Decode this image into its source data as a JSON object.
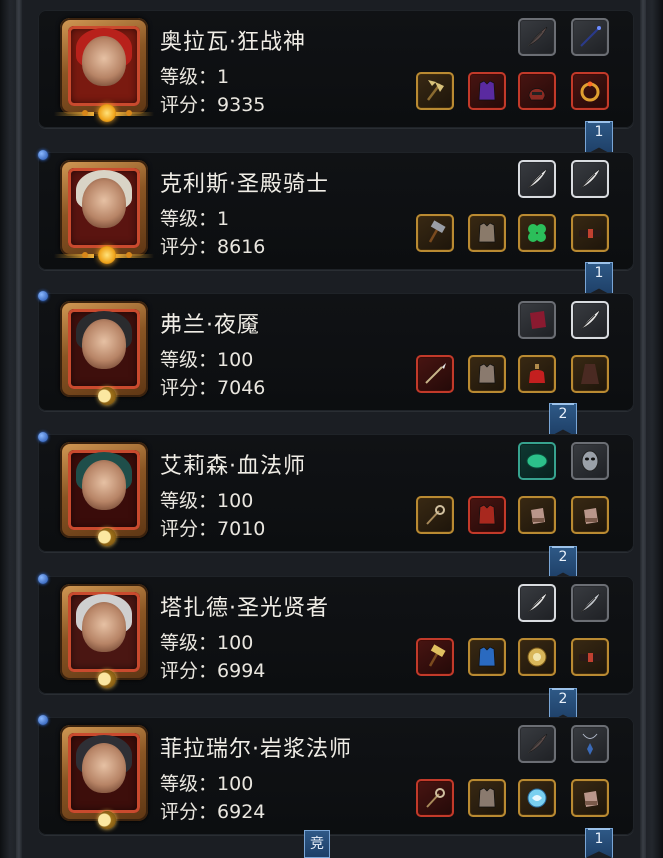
{
  "level_label": "等级：",
  "score_label": "评分：",
  "heroes": [
    {
      "name": "奥拉瓦·狂战神",
      "level": "1",
      "score": "9335",
      "rank_flag": "1",
      "badge": "sun",
      "hair": "#b8211b",
      "bg": "#7a1a10"
    },
    {
      "name": "克利斯·圣殿骑士",
      "level": "1",
      "score": "8616",
      "rank_flag": "1",
      "badge": "sun",
      "hair": "#d9d4c6",
      "bg": "#5a1410"
    },
    {
      "name": "弗兰·夜魇",
      "level": "100",
      "score": "7046",
      "rank_flag": "2",
      "badge": "moon",
      "hair": "#2a2b2e",
      "bg": "#3e0f0c"
    },
    {
      "name": "艾莉森·血法师",
      "level": "100",
      "score": "7010",
      "rank_flag": "2",
      "badge": "moon",
      "hair": "#1f4e4a",
      "bg": "#3a0c0a"
    },
    {
      "name": "塔扎德·圣光贤者",
      "level": "100",
      "score": "6994",
      "rank_flag": "2",
      "badge": "moon",
      "hair": "#cfcfcf",
      "bg": "#4a1612"
    },
    {
      "name": "菲拉瑞尔·岩浆法师",
      "level": "100",
      "score": "6924",
      "rank_flag": "1",
      "badge": "moon",
      "hair": "#2e2f35",
      "bg": "#3d0e0b"
    }
  ],
  "equipment_rows": [
    {
      "top": [
        "dark-feather-icon",
        "dark-wand-icon"
      ],
      "bottom": [
        "gold-axe-icon",
        "purple-armor-icon",
        "red-helm-icon",
        "gold-ring-icon"
      ],
      "top_frames": [
        "grey",
        "grey"
      ],
      "bottom_frames": [
        "gold",
        "red",
        "red",
        "red"
      ]
    },
    {
      "top": [
        "white-feather-icon",
        "white-feather-icon"
      ],
      "bottom": [
        "war-hammer-icon",
        "spiked-armor-icon",
        "green-clover-icon",
        "dark-belt-icon"
      ],
      "top_frames": [
        "white",
        "white"
      ],
      "bottom_frames": [
        "gold",
        "gold",
        "gold",
        "gold"
      ]
    },
    {
      "top": [
        "red-cloth-icon",
        "white-feather-icon"
      ],
      "bottom": [
        "spear-icon",
        "leather-armor-icon",
        "red-potion-icon",
        "dark-cloak-icon"
      ],
      "top_frames": [
        "grey",
        "white"
      ],
      "bottom_frames": [
        "red",
        "gold",
        "gold",
        "gold"
      ]
    },
    {
      "top": [
        "green-gem-icon",
        "silver-mask-icon"
      ],
      "bottom": [
        "magic-staff-icon",
        "red-robe-icon",
        "gauntlet-icon",
        "gauntlet-icon"
      ],
      "top_frames": [
        "teal",
        "grey"
      ],
      "bottom_frames": [
        "gold",
        "red",
        "gold",
        "gold"
      ]
    },
    {
      "top": [
        "white-feather-icon",
        "silver-feather-icon"
      ],
      "bottom": [
        "gold-hammer-icon",
        "blue-cloak-icon",
        "gold-amulet-icon",
        "dark-belt-icon"
      ],
      "top_frames": [
        "white",
        "grey"
      ],
      "bottom_frames": [
        "red",
        "gold",
        "gold",
        "gold"
      ]
    },
    {
      "top": [
        "dark-feather-icon",
        "blue-pendant-icon"
      ],
      "bottom": [
        "fire-staff-icon",
        "leather-armor-icon",
        "blue-orb-icon",
        "gauntlet-icon"
      ],
      "top_frames": [
        "grey",
        "grey"
      ],
      "bottom_frames": [
        "red",
        "gold",
        "gold",
        "gold"
      ]
    }
  ],
  "bottom_tab": "竞"
}
